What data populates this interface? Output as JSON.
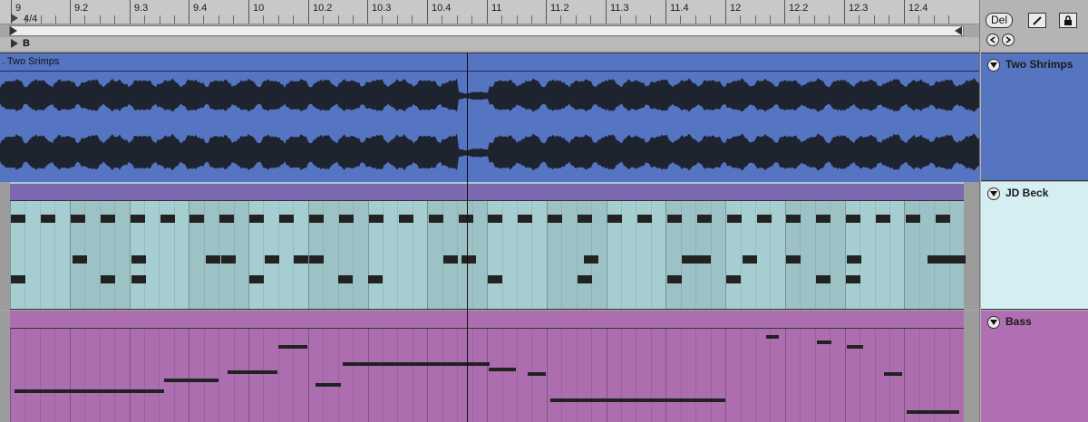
{
  "ruler": {
    "bars": [
      "9",
      "9.2",
      "9.3",
      "9.4",
      "10",
      "10.2",
      "10.3",
      "10.4",
      "11",
      "11.2",
      "11.3",
      "11.4",
      "12",
      "12.2",
      "12.3",
      "12.4"
    ],
    "time_signature": "4/4",
    "marker": "B"
  },
  "transport": {
    "del_label": "Del"
  },
  "tracks": [
    {
      "clip_name": ". Two Srimps",
      "header_name": "Two Shrimps",
      "color": "#5574c1",
      "header_color": "#5575c0"
    },
    {
      "clip_name": "",
      "header_name": "JD Beck",
      "color": "#a6cdd0",
      "header_color": "#d4eef2",
      "clip_bar_color": "#7d68b2"
    },
    {
      "clip_name": "",
      "header_name": "Bass",
      "color": "#ad6eb0",
      "header_color": "#b06fb3"
    }
  ]
}
